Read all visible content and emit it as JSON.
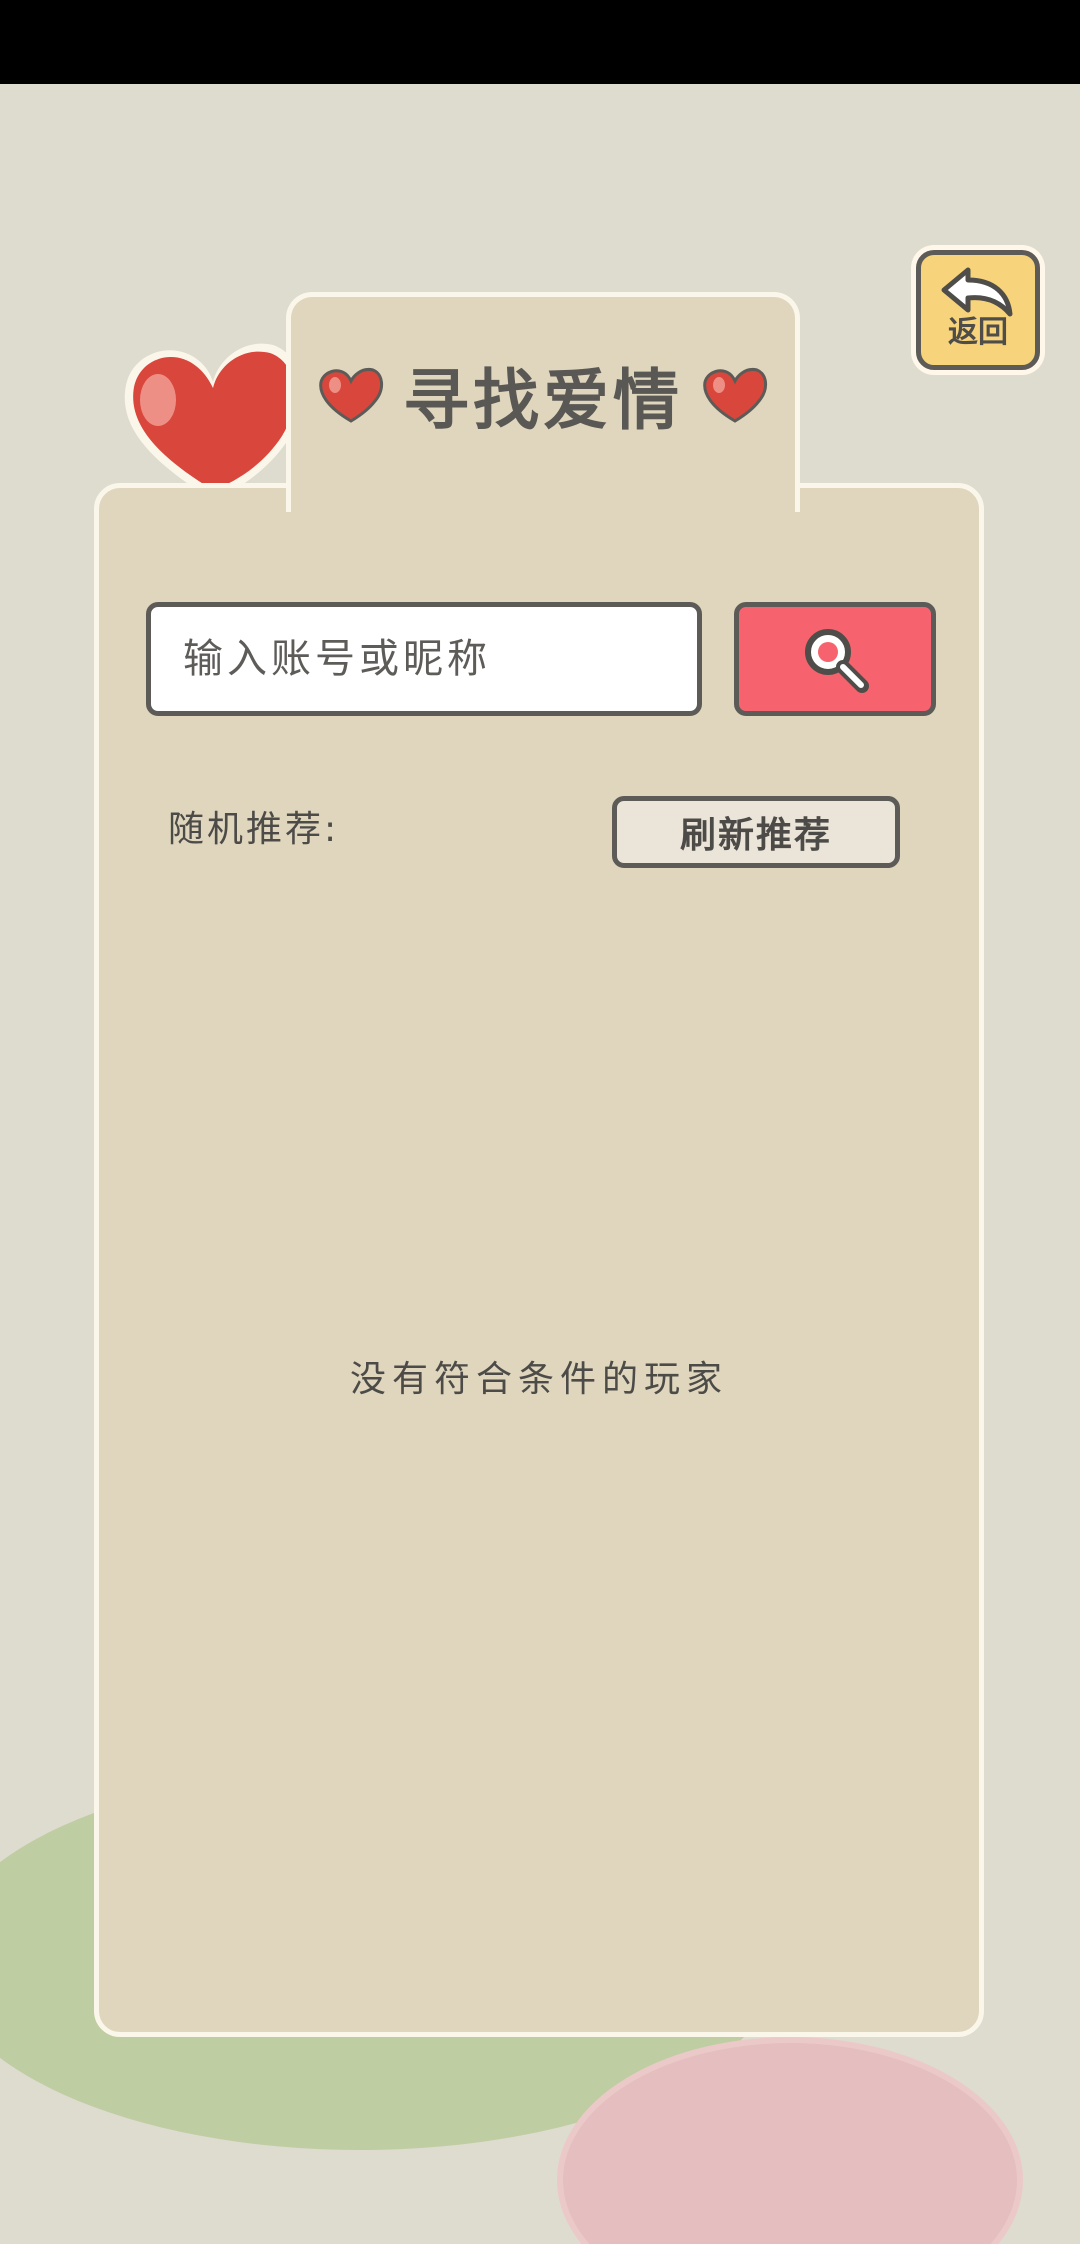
{
  "header": {
    "title": "寻找爱情",
    "back_label": "返回"
  },
  "search": {
    "placeholder": "输入账号或昵称",
    "value": ""
  },
  "recommend": {
    "label": "随机推荐:",
    "refresh_label": "刷新推荐"
  },
  "results": {
    "empty_message": "没有符合条件的玩家"
  },
  "colors": {
    "panel": "#dfd6bd",
    "background": "#dedbcf",
    "search_button": "#f6636e",
    "back_button": "#f7d47b",
    "heart": "#d9463c",
    "outline": "#5d5b58"
  },
  "icons": {
    "back": "back-arrow-icon",
    "search": "magnifier-icon",
    "heart": "heart-icon"
  }
}
